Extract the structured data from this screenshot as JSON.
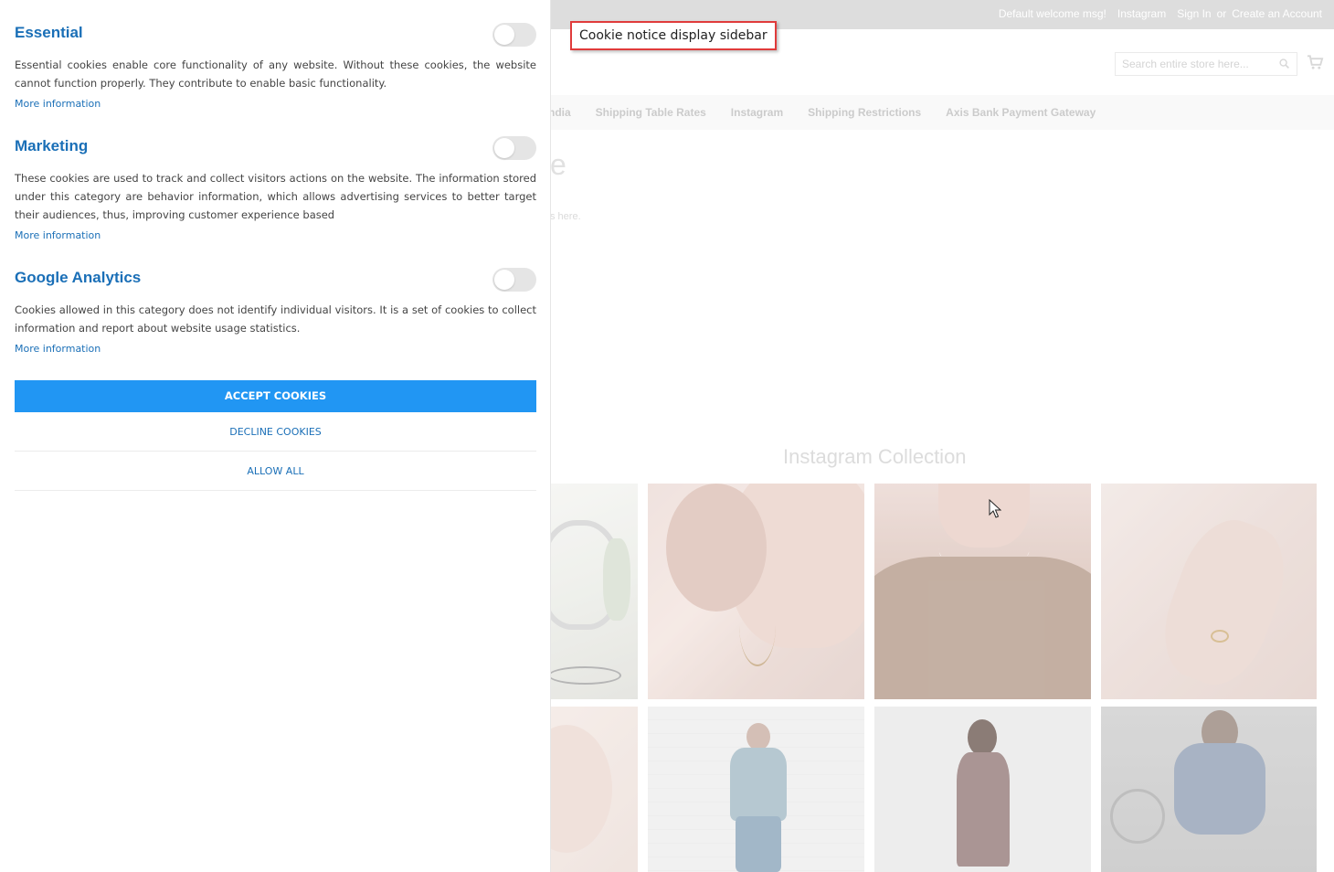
{
  "callout": {
    "label": "Cookie notice display sidebar"
  },
  "store": {
    "top_links": {
      "welcome": "Default welcome msg!",
      "instagram": "Instagram",
      "sign_in": "Sign In",
      "or": "or",
      "create_account": "Create an Account"
    },
    "search": {
      "placeholder": "Search entire store here..."
    },
    "nav": [
      "ndia",
      "Shipping Table Rates",
      "Instagram",
      "Shipping Restrictions",
      "Axis Bank Payment Gateway"
    ],
    "page_heading_fragment": "e",
    "page_sub_fragment": "s here.",
    "instagram_title": "Instagram Collection"
  },
  "sidebar": {
    "sections": [
      {
        "title": "Essential",
        "description": "Essential cookies enable core functionality of any website. Without these cookies, the website cannot function properly. They contribute to enable basic functionality.",
        "more": "More information"
      },
      {
        "title": "Marketing",
        "description": "These cookies are used to track and collect visitors actions on the website. The information stored under this category are behavior information, which allows advertising services to better target their audiences, thus, improving customer experience based",
        "more": "More information"
      },
      {
        "title": "Google Analytics",
        "description": "Cookies allowed in this category does not identify individual visitors. It is a set of cookies to collect information and report about website usage statistics.",
        "more": "More information"
      }
    ],
    "accept_label": "ACCEPT COOKIES",
    "decline_label": "DECLINE COOKIES",
    "allow_all_label": "ALLOW ALL"
  },
  "colors": {
    "accent": "#2196f3",
    "link": "#1a6fb7",
    "callout_border": "#e03b3b"
  }
}
